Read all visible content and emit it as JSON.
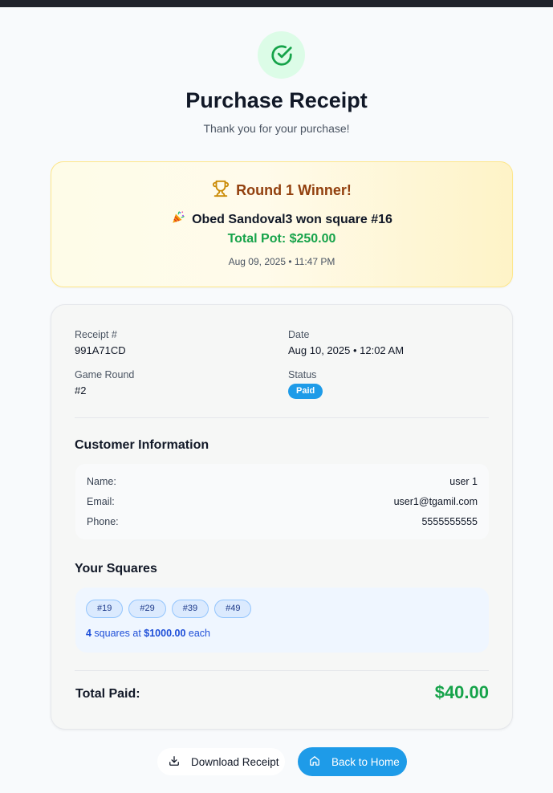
{
  "header": {
    "title": "Purchase Receipt",
    "subtitle": "Thank you for your purchase!",
    "icon": "check-circle-icon"
  },
  "winner": {
    "title": "Round 1 Winner!",
    "line": "Obed Sandoval3 won square #16",
    "pot": "Total Pot: $250.00",
    "date": "Aug 09, 2025 • 11:47 PM",
    "icons": [
      "trophy-icon",
      "party-popper-icon"
    ]
  },
  "receipt": {
    "receipt_label": "Receipt #",
    "receipt_value": "991A71CD",
    "date_label": "Date",
    "date_value": "Aug 10, 2025 • 12:02 AM",
    "round_label": "Game Round",
    "round_value": "#2",
    "status_label": "Status",
    "status_value": "Paid"
  },
  "customer": {
    "section_title": "Customer Information",
    "name_label": "Name:",
    "name_value": "user 1",
    "email_label": "Email:",
    "email_value": "user1@tgamil.com",
    "phone_label": "Phone:",
    "phone_value": "5555555555"
  },
  "squares": {
    "section_title": "Your Squares",
    "items": [
      "#19",
      "#29",
      "#39",
      "#49"
    ],
    "count": "4",
    "text_mid": " squares at ",
    "price": "$1000.00",
    "text_end": " each"
  },
  "total": {
    "label": "Total Paid:",
    "value": "$40.00"
  },
  "actions": {
    "download_label": "Download Receipt",
    "home_label": "Back to Home"
  },
  "colors": {
    "accent_blue": "#1e9be8",
    "success_green": "#16a34a",
    "winner_brown": "#92400e"
  }
}
